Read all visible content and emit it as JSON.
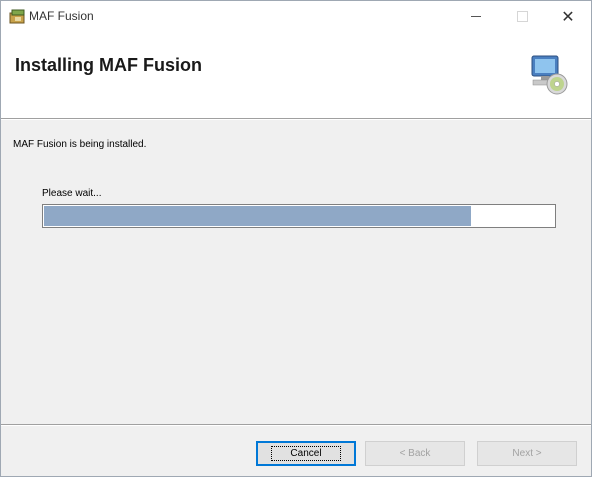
{
  "window": {
    "title": "MAF Fusion",
    "minimize_label": "–",
    "close_label": "✕"
  },
  "header": {
    "title": "Installing MAF Fusion"
  },
  "main": {
    "status_text": "MAF Fusion is being installed.",
    "wait_text": "Please wait...",
    "progress_fraction": 0.837
  },
  "buttons": {
    "cancel": "Cancel",
    "back": "< Back",
    "next": "Next >"
  },
  "colors": {
    "progress_fill": "#8fa8c6",
    "focus_border": "#0078d7"
  },
  "icons": {
    "app": "installer-package-icon",
    "banner": "computer-cd-icon"
  }
}
